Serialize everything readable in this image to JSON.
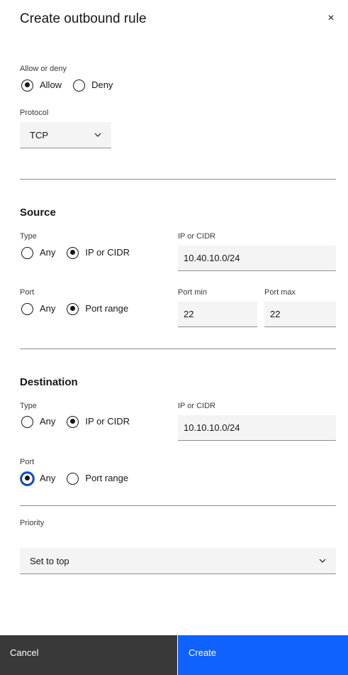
{
  "modal": {
    "title": "Create outbound rule",
    "close_glyph": "×"
  },
  "action": {
    "label": "Allow or deny",
    "options": [
      "Allow",
      "Deny"
    ],
    "selected": "Allow"
  },
  "protocol": {
    "label": "Protocol",
    "value": "TCP"
  },
  "source": {
    "heading": "Source",
    "type_label": "Type",
    "type_options": [
      "Any",
      "IP or CIDR"
    ],
    "type_selected": "IP or CIDR",
    "ip_label": "IP or CIDR",
    "ip_value": "10.40.10.0/24",
    "port_label": "Port",
    "port_options": [
      "Any",
      "Port range"
    ],
    "port_selected": "Port range",
    "port_min_label": "Port min",
    "port_min_value": "22",
    "port_max_label": "Port max",
    "port_max_value": "22"
  },
  "destination": {
    "heading": "Destination",
    "type_label": "Type",
    "type_options": [
      "Any",
      "IP or CIDR"
    ],
    "type_selected": "IP or CIDR",
    "ip_label": "IP or CIDR",
    "ip_value": "10.10.10.0/24",
    "port_label": "Port",
    "port_options": [
      "Any",
      "Port range"
    ],
    "port_selected": "Any"
  },
  "priority": {
    "label": "Priority",
    "value": "Set to top"
  },
  "footer": {
    "cancel_label": "Cancel",
    "create_label": "Create"
  },
  "colors": {
    "primary": "#0f62fe",
    "secondary": "#393939",
    "field_bg": "#f4f4f4"
  },
  "icons": {
    "close": "close-icon",
    "dropdown": "chevron-down-icon"
  }
}
